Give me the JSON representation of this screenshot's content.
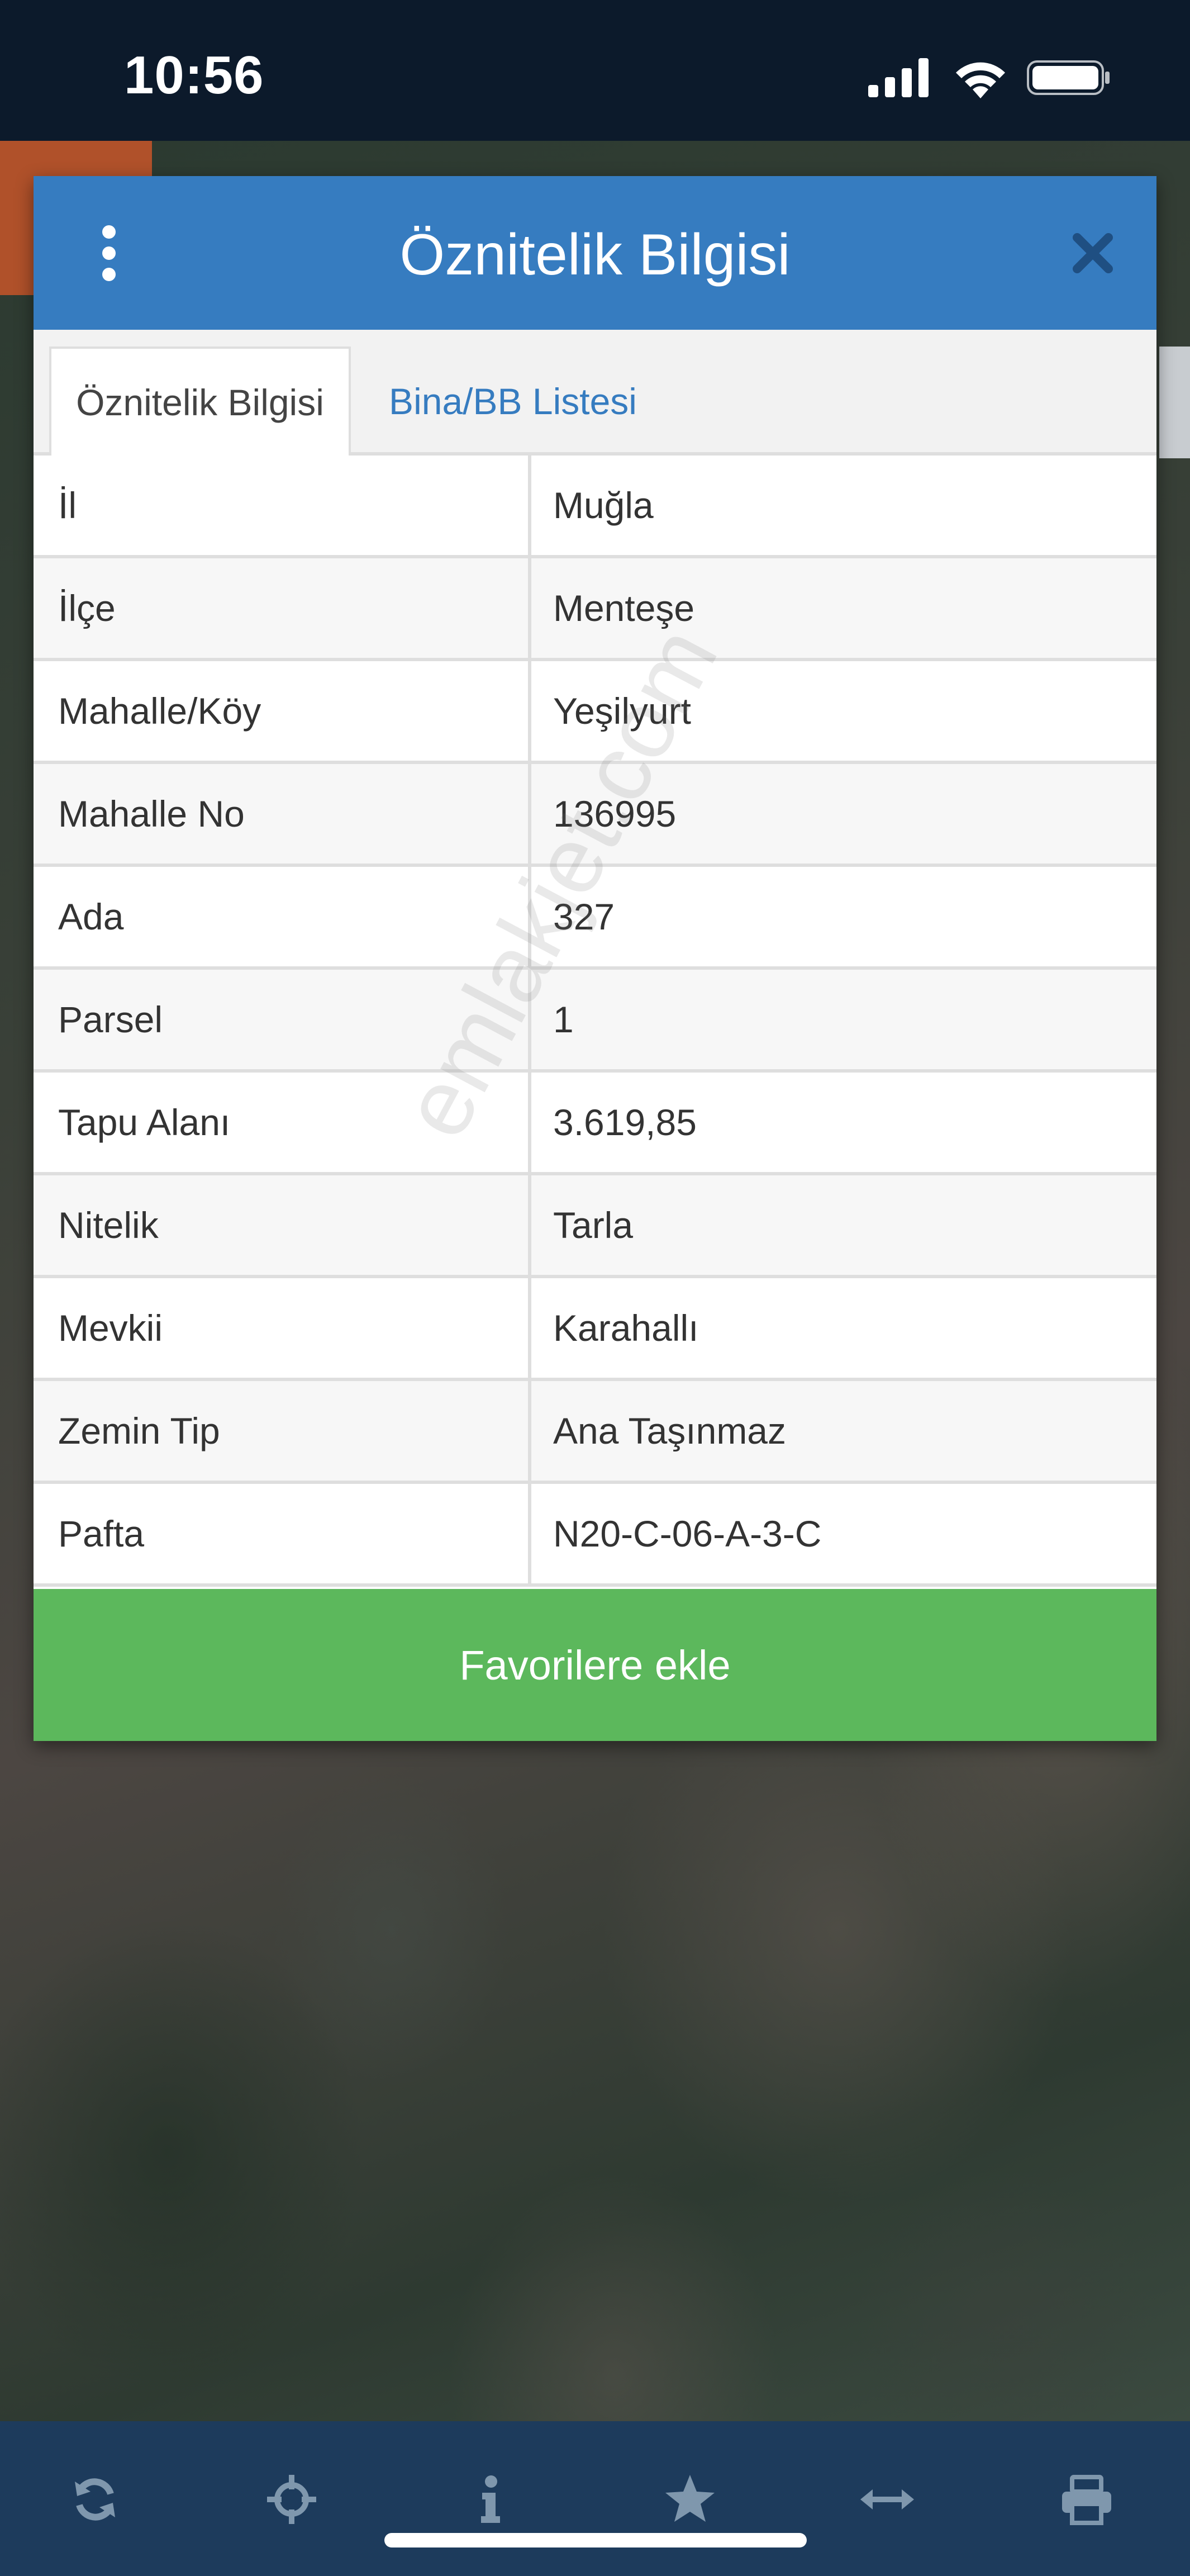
{
  "status_bar": {
    "time": "10:56"
  },
  "dialog": {
    "title": "Öznitelik Bilgisi",
    "tabs": [
      {
        "label": "Öznitelik Bilgisi",
        "active": true
      },
      {
        "label": "Bina/BB Listesi",
        "active": false
      }
    ],
    "rows": [
      {
        "key": "İl",
        "value": "Muğla"
      },
      {
        "key": "İlçe",
        "value": "Menteşe"
      },
      {
        "key": "Mahalle/Köy",
        "value": "Yeşilyurt"
      },
      {
        "key": "Mahalle No",
        "value": "136995"
      },
      {
        "key": "Ada",
        "value": "327"
      },
      {
        "key": "Parsel",
        "value": "1"
      },
      {
        "key": "Tapu Alanı",
        "value": "3.619,85"
      },
      {
        "key": "Nitelik",
        "value": "Tarla"
      },
      {
        "key": "Mevkii",
        "value": "Karahallı"
      },
      {
        "key": "Zemin Tip",
        "value": "Ana Taşınmaz"
      },
      {
        "key": "Pafta",
        "value": "N20-C-06-A-3-C"
      }
    ],
    "favorite_button": "Favorilere ekle",
    "watermark": "emlakjet.com"
  },
  "toolbar": {
    "icons": [
      "refresh-icon",
      "locate-icon",
      "info-icon",
      "star-icon",
      "measure-icon",
      "print-icon"
    ]
  },
  "colors": {
    "header_blue": "#367cc0",
    "button_green": "#5cb85c",
    "toolbar": "#1d3b5c",
    "toolbar_icon": "#7f97ad",
    "status_bar": "#0c1a2b"
  }
}
